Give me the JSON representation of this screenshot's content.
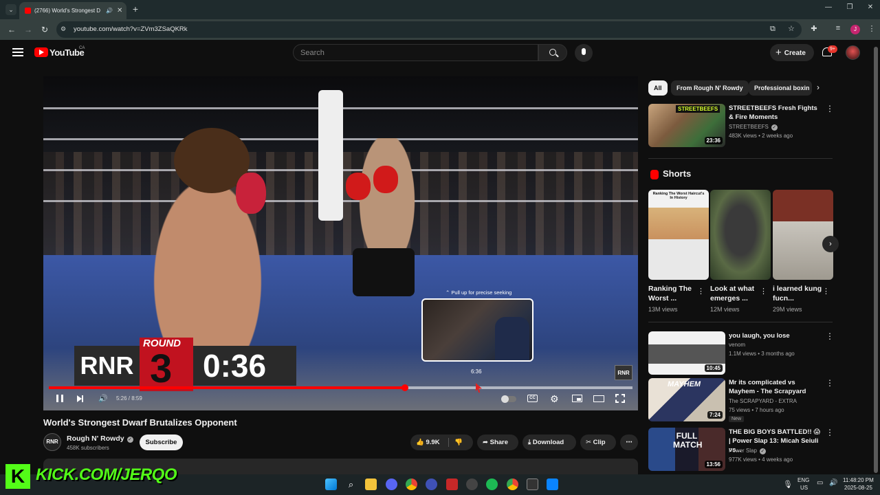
{
  "browser": {
    "tab_title": "(2766) World's Strongest D",
    "url": "youtube.com/watch?v=ZVm3ZSaQKRk"
  },
  "youtube": {
    "logo_text": "YouTube",
    "country_code": "CA",
    "search_placeholder": "Search",
    "create_label": "Create",
    "notif_badge": "9+"
  },
  "player": {
    "pullup_hint": "⌃ Pull up for precise seeking",
    "preview_time": "6:36",
    "current_time": "5:26 / 8:59",
    "progress_played": 0.61,
    "progress_buffered": 1.0,
    "overlay": {
      "rnr": "RNR",
      "round_label": "ROUND",
      "round_number": "3",
      "clock": "0:36",
      "watermark": "RNR"
    }
  },
  "video": {
    "title": "World's Strongest Dwarf Brutalizes Opponent",
    "channel_avatar": "RNR",
    "channel_name": "Rough N' Rowdy",
    "subscribers": "458K subscribers",
    "subscribe_label": "Subscribe",
    "likes": "9.9K",
    "share_label": "Share",
    "download_label": "Download",
    "clip_label": "Clip"
  },
  "sidebar": {
    "chips": [
      "All",
      "From Rough N' Rowdy",
      "Professional boxin"
    ],
    "top_rec": {
      "title": "STREETBEEFS Fresh Fights & Fire Moments",
      "channel": "STREETBEEFS",
      "meta": "483K views • 2 weeks ago",
      "duration": "23:36",
      "thumb_text": "STREETBEEFS"
    },
    "shorts_header": "Shorts",
    "shorts": [
      {
        "title": "Ranking The Worst ...",
        "views": "13M views",
        "thumb_text": "Ranking The Worst Haircut's In History"
      },
      {
        "title": "Look at what emerges ...",
        "views": "12M views"
      },
      {
        "title": "i learned kung fucn...",
        "views": "29M views"
      }
    ],
    "recs": [
      {
        "title": "you laugh, you lose",
        "channel": "venom",
        "meta": "1.1M views • 3 months ago",
        "duration": "10:45"
      },
      {
        "title": "Mr its complicated vs Mayhem - The Scrapyard",
        "channel": "The SCRAPYARD - EXTRA",
        "meta": "75 views • 7 hours ago",
        "duration": "7:24",
        "badge": "New",
        "thumb_text": "MAYHEM"
      },
      {
        "title": "THE BIG BOYS BATTLED!! 😱 | Power Slap 13: Micah Seiuli vs...",
        "channel": "Power Slap",
        "meta": "977K views • 4 weeks ago",
        "duration": "13:56",
        "thumb_text": "FULL MATCH"
      }
    ]
  },
  "stream_overlay": {
    "kick_letter": "K",
    "kick_text": "KICK.COM/JERQO"
  },
  "taskbar": {
    "lang": "ENG",
    "region": "US",
    "time": "11:48:20 PM",
    "date": "2025-08-25"
  }
}
